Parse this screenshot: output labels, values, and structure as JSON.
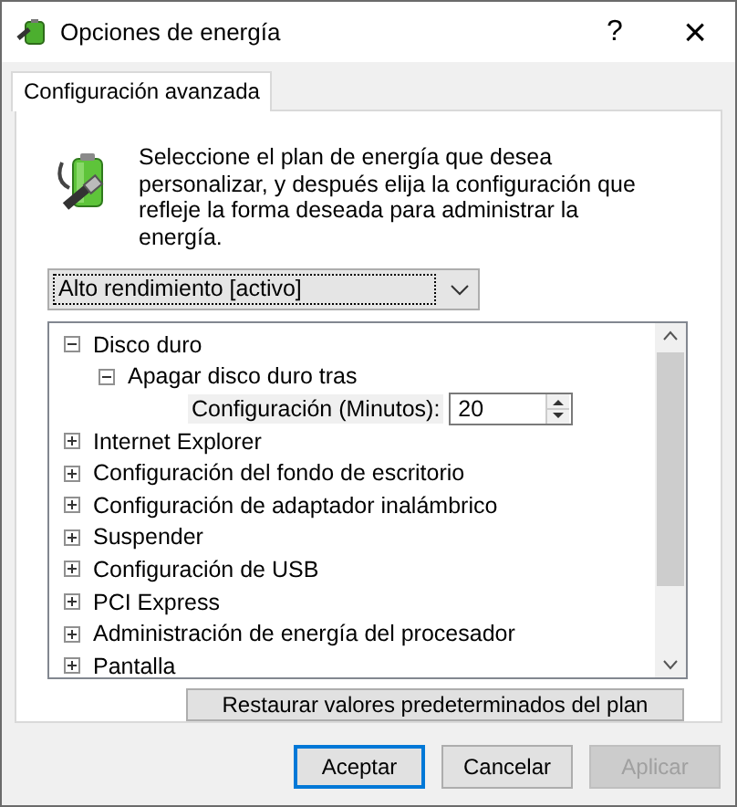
{
  "window": {
    "title": "Opciones de energía",
    "help_button": "?",
    "close_button": "×"
  },
  "tabs": [
    {
      "label": "Configuración avanzada",
      "selected": true
    }
  ],
  "description": "Seleccione el plan de energía que desea personalizar, y después elija la configuración que refleje la forma deseada para administrar la energía.",
  "plan_dropdown": {
    "value": "Alto rendimiento [activo]"
  },
  "settings_tree": [
    {
      "label": "Disco duro",
      "expanded": true,
      "children": [
        {
          "label": "Apagar disco duro tras",
          "expanded": true,
          "children": [
            {
              "kind": "setting",
              "label": "Configuración (Minutos):",
              "value": "20"
            }
          ]
        }
      ]
    },
    {
      "label": "Internet Explorer",
      "expanded": false
    },
    {
      "label": "Configuración del fondo de escritorio",
      "expanded": false
    },
    {
      "label": "Configuración de adaptador inalámbrico",
      "expanded": false
    },
    {
      "label": "Suspender",
      "expanded": false
    },
    {
      "label": "Configuración de USB",
      "expanded": false
    },
    {
      "label": "PCI Express",
      "expanded": false
    },
    {
      "label": "Administración de energía del procesador",
      "expanded": false
    },
    {
      "label": "Pantalla",
      "expanded": false
    }
  ],
  "restore_button": "Restaurar valores predeterminados del plan",
  "buttons": [
    {
      "label": "Aceptar",
      "default": true,
      "disabled": false
    },
    {
      "label": "Cancelar",
      "default": false,
      "disabled": false
    },
    {
      "label": "Aplicar",
      "default": false,
      "disabled": true
    }
  ]
}
